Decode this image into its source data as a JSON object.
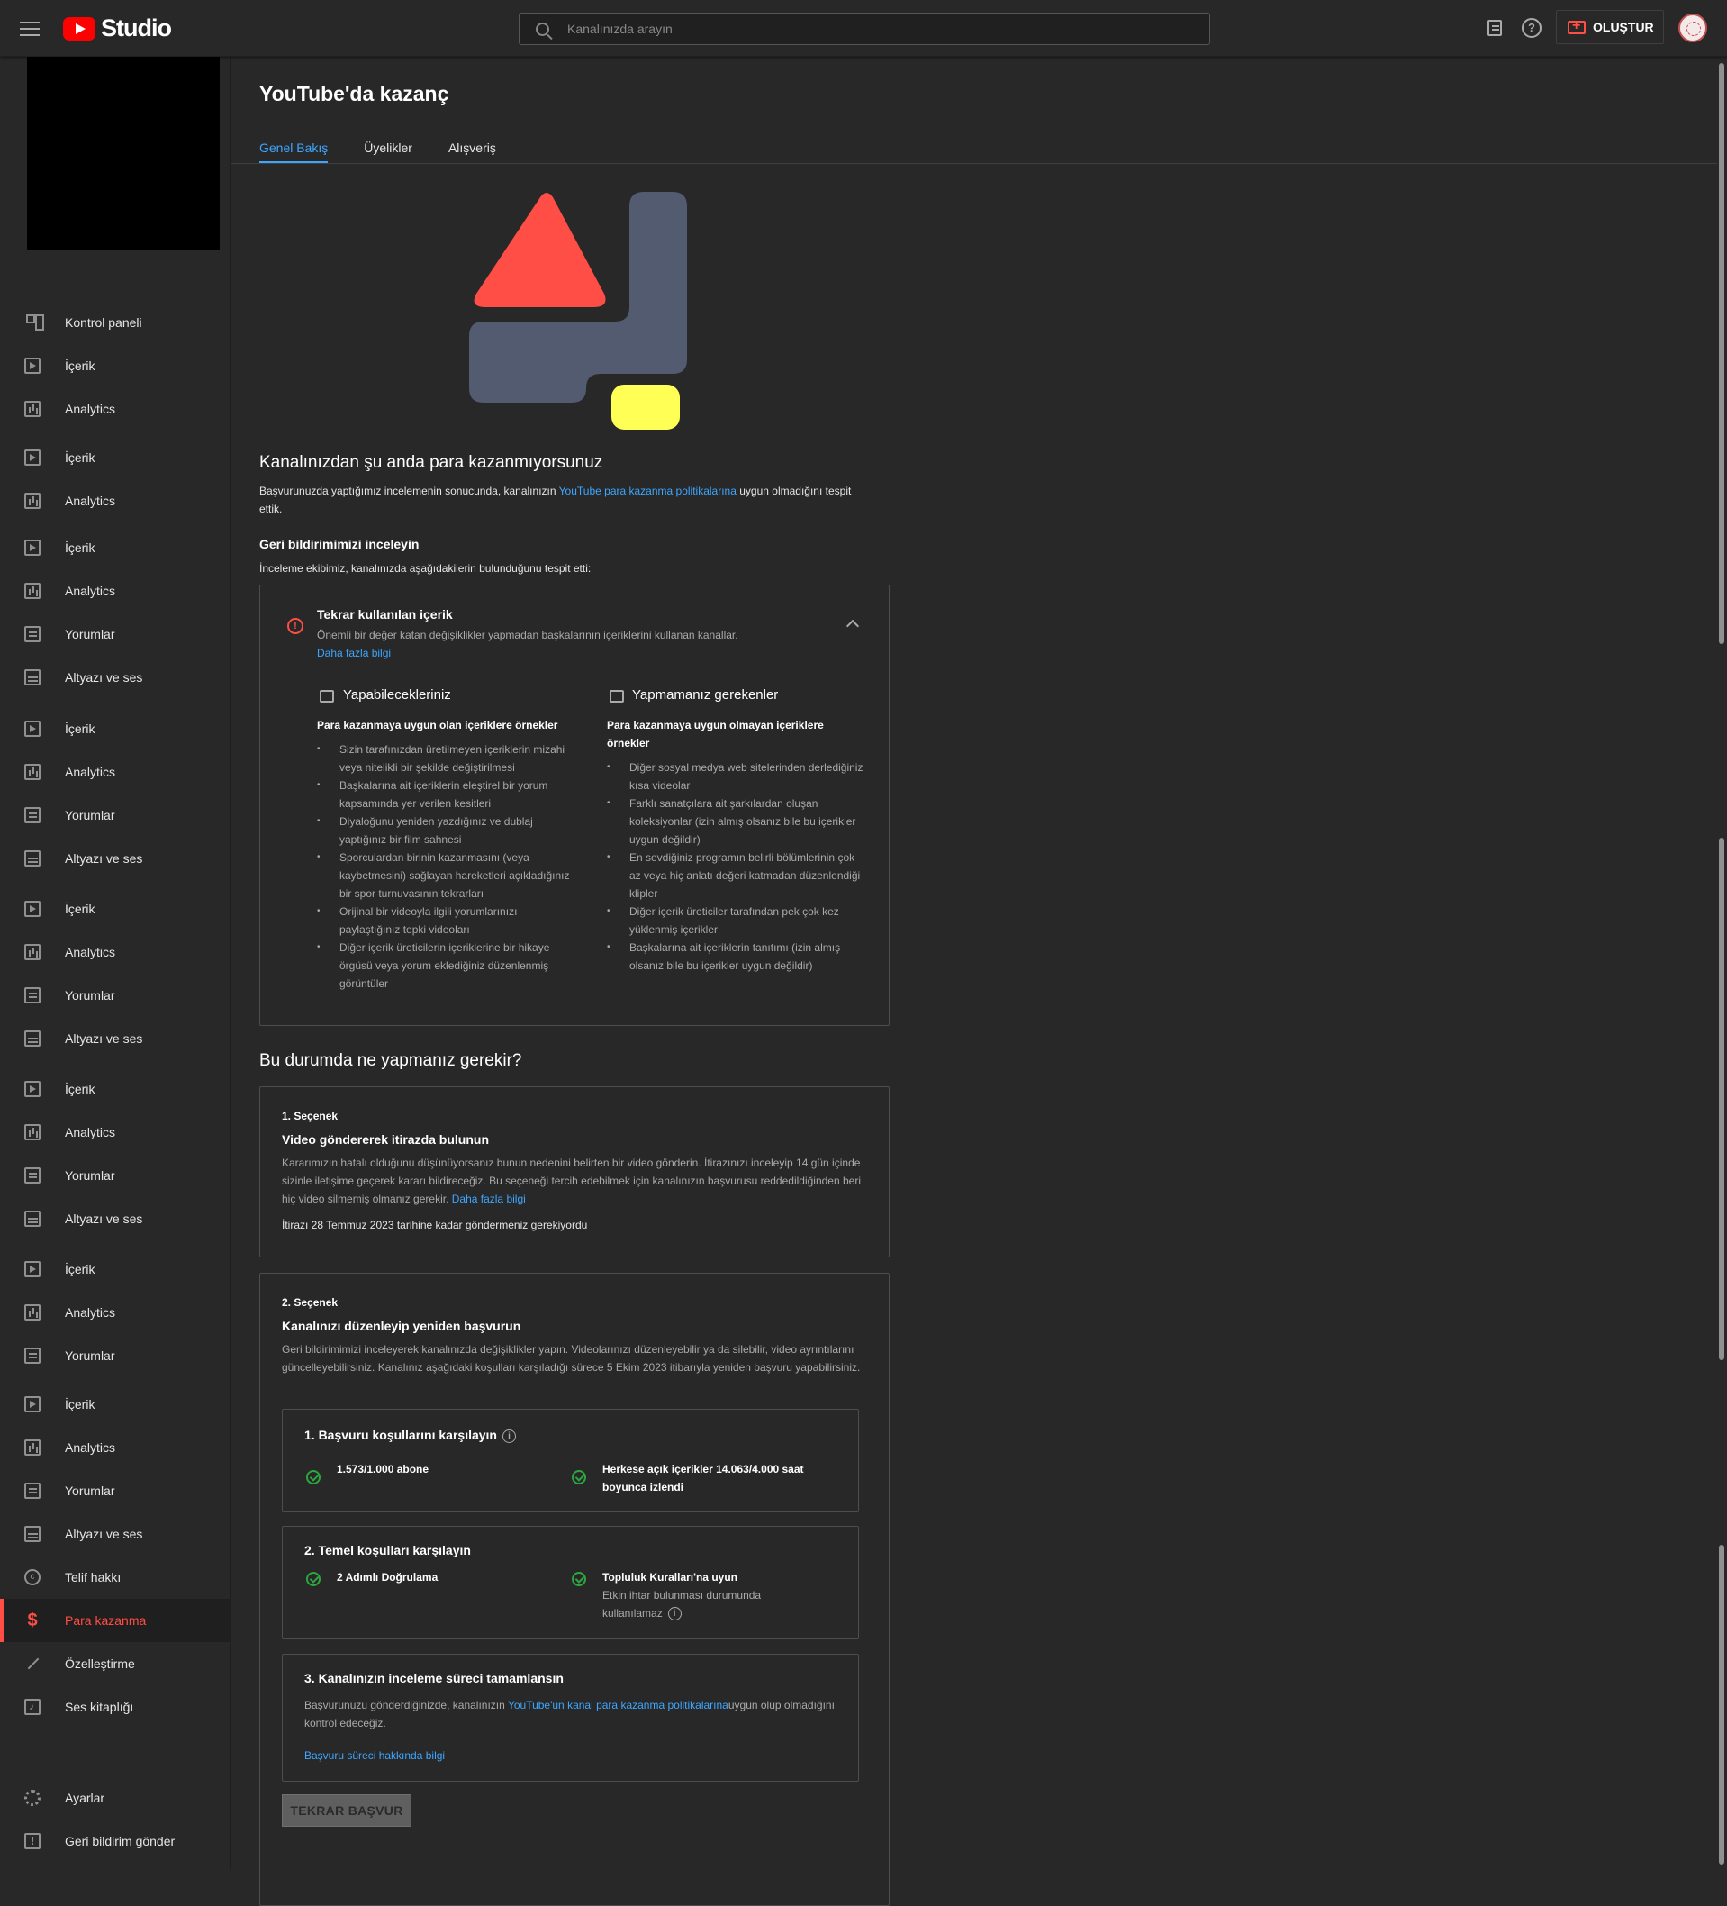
{
  "topbar": {
    "logo_text": "Studio",
    "search_placeholder": "Kanalınızda arayın",
    "create_label": "OLUŞTUR"
  },
  "sidebar": {
    "items": [
      {
        "label": "Kontrol paneli",
        "icon": "dashboard-icon"
      },
      {
        "label": "İçerik",
        "icon": "content-icon"
      },
      {
        "label": "Analytics",
        "icon": "analytics-icon"
      },
      {
        "label": "İçerik",
        "icon": "content-icon"
      },
      {
        "label": "Analytics",
        "icon": "analytics-icon"
      },
      {
        "label": "İçerik",
        "icon": "content-icon"
      },
      {
        "label": "Analytics",
        "icon": "analytics-icon"
      },
      {
        "label": "Yorumlar",
        "icon": "comments-icon"
      },
      {
        "label": "Altyazı ve ses",
        "icon": "subtitles-icon"
      },
      {
        "label": "İçerik",
        "icon": "content-icon"
      },
      {
        "label": "Analytics",
        "icon": "analytics-icon"
      },
      {
        "label": "Yorumlar",
        "icon": "comments-icon"
      },
      {
        "label": "Altyazı ve ses",
        "icon": "subtitles-icon"
      },
      {
        "label": "İçerik",
        "icon": "content-icon"
      },
      {
        "label": "Analytics",
        "icon": "analytics-icon"
      },
      {
        "label": "Yorumlar",
        "icon": "comments-icon"
      },
      {
        "label": "Altyazı ve ses",
        "icon": "subtitles-icon"
      },
      {
        "label": "İçerik",
        "icon": "content-icon"
      },
      {
        "label": "Analytics",
        "icon": "analytics-icon"
      },
      {
        "label": "Yorumlar",
        "icon": "comments-icon"
      },
      {
        "label": "Altyazı ve ses",
        "icon": "subtitles-icon"
      },
      {
        "label": "İçerik",
        "icon": "content-icon"
      },
      {
        "label": "Analytics",
        "icon": "analytics-icon"
      },
      {
        "label": "Yorumlar",
        "icon": "comments-icon"
      },
      {
        "label": "İçerik",
        "icon": "content-icon"
      },
      {
        "label": "Analytics",
        "icon": "analytics-icon"
      },
      {
        "label": "Yorumlar",
        "icon": "comments-icon"
      },
      {
        "label": "Altyazı ve ses",
        "icon": "subtitles-icon"
      },
      {
        "label": "Telif hakkı",
        "icon": "copyright-icon"
      },
      {
        "label": "Para kazanma",
        "icon": "dollar-icon",
        "active": true
      },
      {
        "label": "Özelleştirme",
        "icon": "magic-wand-icon"
      },
      {
        "label": "Ses kitaplığı",
        "icon": "audio-library-icon"
      }
    ],
    "settings_label": "Ayarlar",
    "feedback_label": "Geri bildirim gönder"
  },
  "main": {
    "title": "YouTube'da kazanç",
    "tabs": [
      "Genel Bakış",
      "Üyelikler",
      "Alışveriş"
    ],
    "status_title": "Kanalınızdan şu anda para kazanmıyorsunuz",
    "status_text_1": "Başvurunuzda yaptığımız incelemenin sonucunda, kanalınızın ",
    "status_link": "YouTube para kazanma politikalarına",
    "status_text_2": " uygun olmadığını tespit ettik.",
    "feedback_title": "Geri bildirimimizi inceleyin",
    "feedback_sub": "İnceleme ekibimiz, kanalınızda aşağıdakilerin bulunduğunu tespit etti:",
    "issue": {
      "title": "Tekrar kullanılan içerik",
      "desc": "Önemli bir değer katan değişiklikler yapmadan başkalarının içeriklerini kullanan kanallar.",
      "learn_more": "Daha fazla bilgi",
      "do_title": "Yapabilecekleriniz",
      "do_sub": "Para kazanmaya uygun olan içeriklere örnekler",
      "do_items": [
        "Sizin tarafınızdan üretilmeyen içeriklerin mizahi veya nitelikli bir şekilde değiştirilmesi",
        "Başkalarına ait içeriklerin eleştirel bir yorum kapsamında yer verilen kesitleri",
        "Diyaloğunu yeniden yazdığınız ve dublaj yaptığınız bir film sahnesi",
        "Sporculardan birinin kazanmasını (veya kaybetmesini) sağlayan hareketleri açıkladığınız bir spor turnuvasının tekrarları",
        "Orijinal bir videoyla ilgili yorumlarınızı paylaştığınız tepki videoları",
        "Diğer içerik üreticilerin içeriklerine bir hikaye örgüsü veya yorum eklediğiniz düzenlenmiş görüntüler"
      ],
      "dont_title": "Yapmamanız gerekenler",
      "dont_sub": "Para kazanmaya uygun olmayan içeriklere örnekler",
      "dont_items": [
        "Diğer sosyal medya web sitelerinden derlediğiniz kısa videolar",
        "Farklı sanatçılara ait şarkılardan oluşan koleksiyonlar (izin almış olsanız bile bu içerikler uygun değildir)",
        "En sevdiğiniz programın belirli bölümlerinin çok az veya hiç anlatı değeri katmadan düzenlendiği klipler",
        "Diğer içerik üreticiler tarafından pek çok kez yüklenmiş içerikler",
        "Başkalarına ait içeriklerin tanıtımı (izin almış olsanız bile bu içerikler uygun değildir)"
      ]
    },
    "what_title": "Bu durumda ne yapmanız gerekir?",
    "option1": {
      "label": "1. Seçenek",
      "title": "Video göndererek itirazda bulunun",
      "desc": "Kararımızın hatalı olduğunu düşünüyorsanız bunun nedenini belirten bir video gönderin. İtirazınızı inceleyip 14 gün içinde sizinle iletişime geçerek kararı bildireceğiz. Bu seçeneği tercih edebilmek için kanalınızın başvurusu reddedildiğinden beri hiç video silmemiş olmanız gerekir. ",
      "learn_more": "Daha fazla bilgi",
      "deadline": "İtirazı 28 Temmuz 2023 tarihine kadar göndermeniz gerekiyordu"
    },
    "option2": {
      "label": "2. Seçenek",
      "title": "Kanalınızı düzenleyip yeniden başvurun",
      "desc": "Geri bildirimimizi inceleyerek kanalınızda değişiklikler yapın. Videolarınızı düzenleyebilir ya da silebilir, video ayrıntılarını güncelleyebilirsiniz. Kanalınız aşağıdaki koşulları karşıladığı sürece 5 Ekim 2023 itibarıyla yeniden başvuru yapabilirsiniz.",
      "req1_title": "1. Başvuru koşullarını karşılayın",
      "req1_a": "1.573/1.000 abone",
      "req1_b": "Herkese açık içerikler 14.063/4.000 saat boyunca izlendi",
      "req2_title": "2. Temel koşulları karşılayın",
      "req2_a": "2 Adımlı Doğrulama",
      "req2_b": "Topluluk Kuralları'na uyun",
      "req2_b_sub": "Etkin ihtar bulunması durumunda kullanılamaz",
      "req3_title": "3. Kanalınızın inceleme süreci tamamlansın",
      "req3_text_1": "Başvurunuzu gönderdiğinizde, kanalınızın ",
      "req3_link": "YouTube'un kanal para kazanma politikalarına",
      "req3_text_2": "uygun olup olmadığını kontrol edeceğiz.",
      "req3_learn": "Başvuru süreci hakkında bilgi",
      "reapply_label": "TEKRAR BAŞVUR"
    }
  },
  "colors": {
    "accent": "#3ea6ff",
    "brand": "#ff0000",
    "active": "#ff4e45",
    "success": "#2ba640",
    "hero_red": "#ff4e45",
    "hero_slate": "#525b6f",
    "hero_yellow": "#ffff55"
  }
}
